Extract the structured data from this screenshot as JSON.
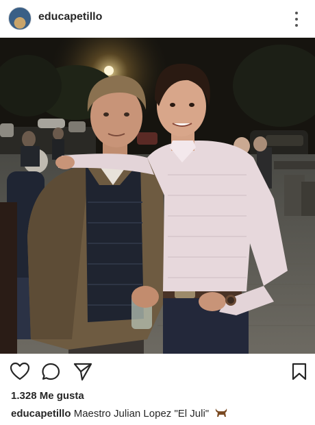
{
  "post": {
    "username": "educapetillo",
    "likes": "1.328 Me gusta",
    "caption_user": "educapetillo",
    "caption_text": "Maestro Julian Lopez \"El Juli\""
  },
  "icons": {
    "avatar": "profile-avatar",
    "more": "more-options-icon",
    "like": "heart-icon",
    "comment": "comment-icon",
    "share": "paper-plane-icon",
    "save": "bookmark-icon",
    "caption_emoji": "bull-emoji"
  },
  "colors": {
    "text": "#262626",
    "background": "#ffffff",
    "icon": "#262626"
  }
}
